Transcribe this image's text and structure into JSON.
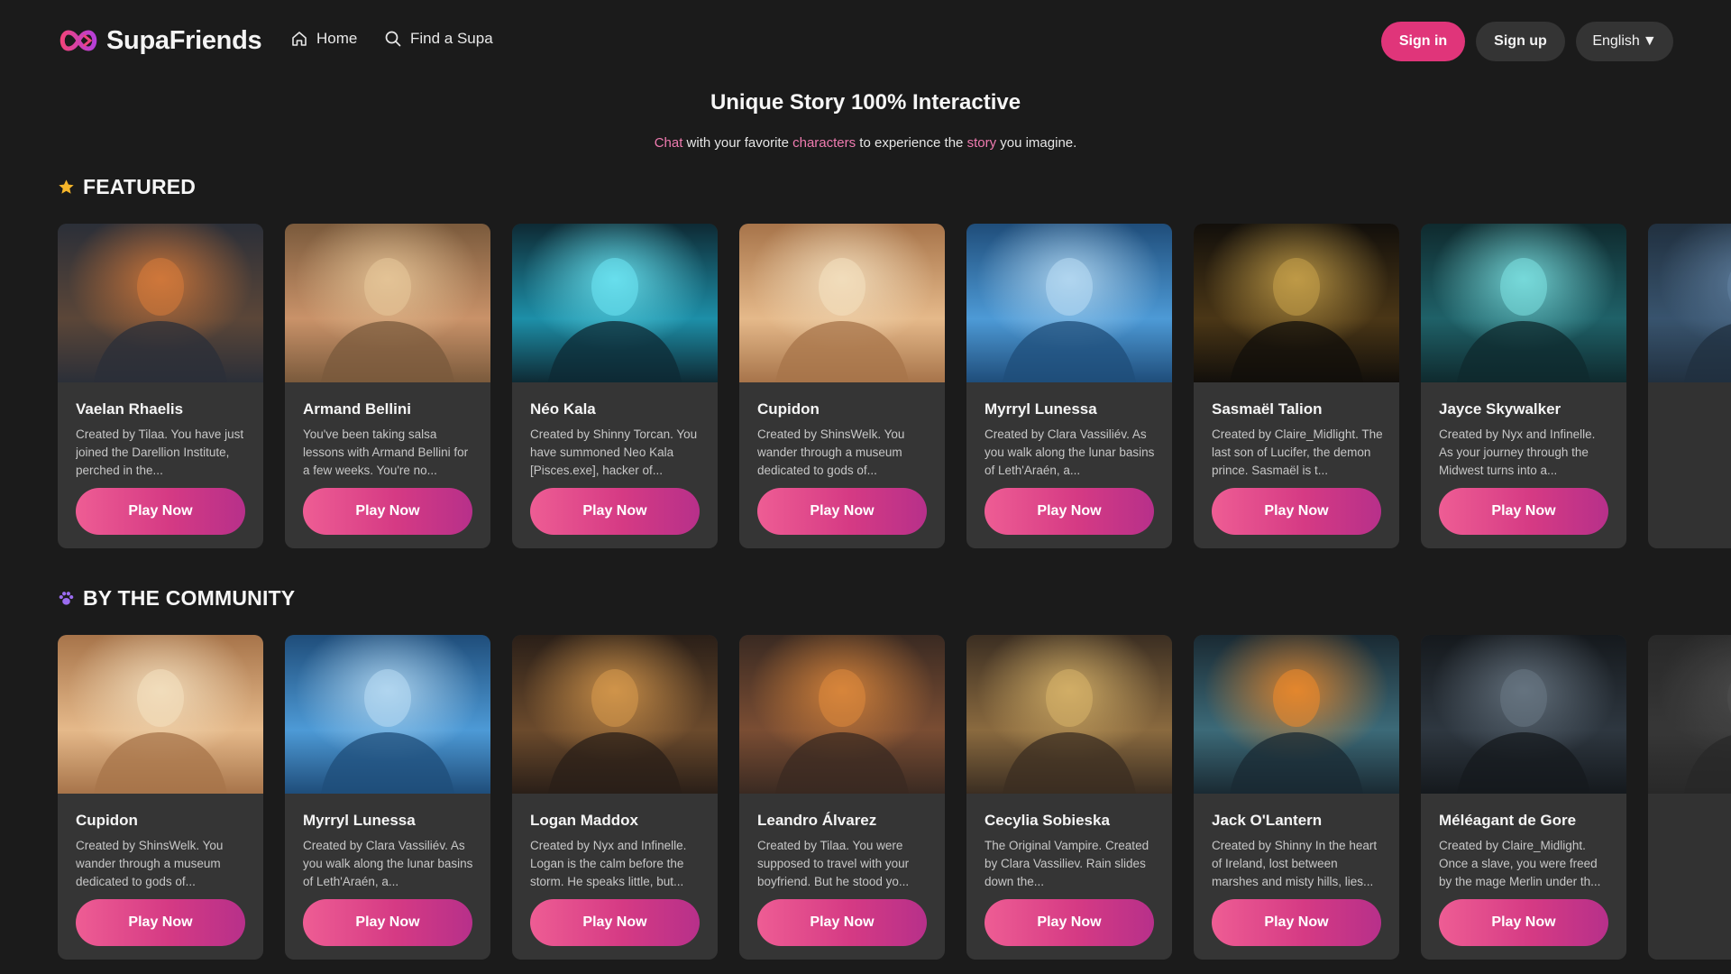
{
  "header": {
    "brand": "SupaFriends",
    "nav": [
      {
        "label": "Home",
        "icon": "home-icon"
      },
      {
        "label": "Find a Supa",
        "icon": "search-icon"
      }
    ],
    "sign_in": "Sign in",
    "sign_up": "Sign up",
    "language": "English",
    "language_caret": "▼"
  },
  "hero": {
    "title": "Unique Story 100% Interactive",
    "sub_chat": "Chat",
    "sub_t1": " with your favorite ",
    "sub_characters": "characters",
    "sub_t2": " to experience the ",
    "sub_story": "story",
    "sub_t3": " you imagine."
  },
  "colors": {
    "accent": "#e0357a",
    "highlight": "#ef7bb0",
    "background": "#1b1b1b",
    "card": "#353535"
  },
  "featured": {
    "title": "FEATURED",
    "icon": "star-icon",
    "cards": [
      {
        "name": "Vaelan Rhaelis",
        "desc": "Created by Tilaa. You have just joined the Darellion Institute, perched in the...",
        "button": "Play Now",
        "palette": [
          "#2b2f38",
          "#5b4638",
          "#d97b3a"
        ]
      },
      {
        "name": "Armand Bellini",
        "desc": "You've been taking salsa lessons with Armand Bellini for a few weeks. You're no...",
        "button": "Play Now",
        "palette": [
          "#7a5a3c",
          "#c99269",
          "#e8c89a"
        ]
      },
      {
        "name": "Néo Kala",
        "desc": "Created by Shinny Torcan. You have summoned Neo Kala [Pisces.exe], hacker of...",
        "button": "Play Now",
        "palette": [
          "#0e2a34",
          "#1d8fa8",
          "#6ee8f5"
        ]
      },
      {
        "name": "Cupidon",
        "desc": "Created by ShinsWelk. You wander through a museum dedicated to gods of...",
        "button": "Play Now",
        "palette": [
          "#a7744a",
          "#e5b98a",
          "#f4e1c1"
        ]
      },
      {
        "name": "Myrryl Lunessa",
        "desc": "Created by Clara Vassiliév. As you walk along the lunar basins of Leth'Araén, a...",
        "button": "Play Now",
        "palette": [
          "#1f4d7a",
          "#4d9ad6",
          "#b9dcf4"
        ]
      },
      {
        "name": "Sasmaël Talion",
        "desc": "Created by Claire_Midlight. The last son of Lucifer, the demon prince. Sasmaël is t...",
        "button": "Play Now",
        "palette": [
          "#120f0b",
          "#4a3616",
          "#c9a24a"
        ]
      },
      {
        "name": "Jayce Skywalker",
        "desc": "Created by Nyx and Infinelle. As your journey through the Midwest turns into a...",
        "button": "Play Now",
        "palette": [
          "#0f2a2e",
          "#1f6168",
          "#7de3e4"
        ]
      },
      {
        "name": "",
        "desc": "",
        "button": "",
        "palette": [
          "#223344",
          "#3c5a77",
          "#6b8fb3"
        ]
      }
    ]
  },
  "community": {
    "title": "BY THE COMMUNITY",
    "icon": "paw-icon",
    "cards": [
      {
        "name": "Cupidon",
        "desc": "Created by ShinsWelk. You wander through a museum dedicated to gods of...",
        "button": "Play Now",
        "palette": [
          "#a7744a",
          "#e5b98a",
          "#f4e1c1"
        ]
      },
      {
        "name": "Myrryl Lunessa",
        "desc": "Created by Clara Vassiliév. As you walk along the lunar basins of Leth'Araén, a...",
        "button": "Play Now",
        "palette": [
          "#1f4d7a",
          "#4d9ad6",
          "#b9dcf4"
        ]
      },
      {
        "name": "Logan Maddox",
        "desc": "Created by Nyx and Infinelle. Logan is the calm before the storm. He speaks little, but...",
        "button": "Play Now",
        "palette": [
          "#2a1f18",
          "#6b4a2c",
          "#d99a4d"
        ]
      },
      {
        "name": "Leandro Álvarez",
        "desc": "Created by Tilaa. You were supposed to travel with your boyfriend. But he stood yo...",
        "button": "Play Now",
        "palette": [
          "#3a2a22",
          "#7a4d33",
          "#e08a3c"
        ]
      },
      {
        "name": "Cecylia Sobieska",
        "desc": "The Original Vampire. Created by Clara Vassiliev. Rain slides down the...",
        "button": "Play Now",
        "palette": [
          "#3b2e22",
          "#8a6a3f",
          "#d9b46a"
        ]
      },
      {
        "name": "Jack O'Lantern",
        "desc": "Created by Shinny In the heart of Ireland, lost between marshes and misty hills, lies...",
        "button": "Play Now",
        "palette": [
          "#1a2a33",
          "#3c6a78",
          "#f08a2a"
        ]
      },
      {
        "name": "Méléagant de Gore",
        "desc": "Created by Claire_Midlight. Once a slave, you were freed by the mage Merlin under th...",
        "button": "Play Now",
        "palette": [
          "#15191d",
          "#2e3740",
          "#6a7885"
        ]
      },
      {
        "name": "",
        "desc": "",
        "button": "",
        "palette": [
          "#2a2a2a",
          "#3a3a3a",
          "#555555"
        ]
      }
    ]
  }
}
